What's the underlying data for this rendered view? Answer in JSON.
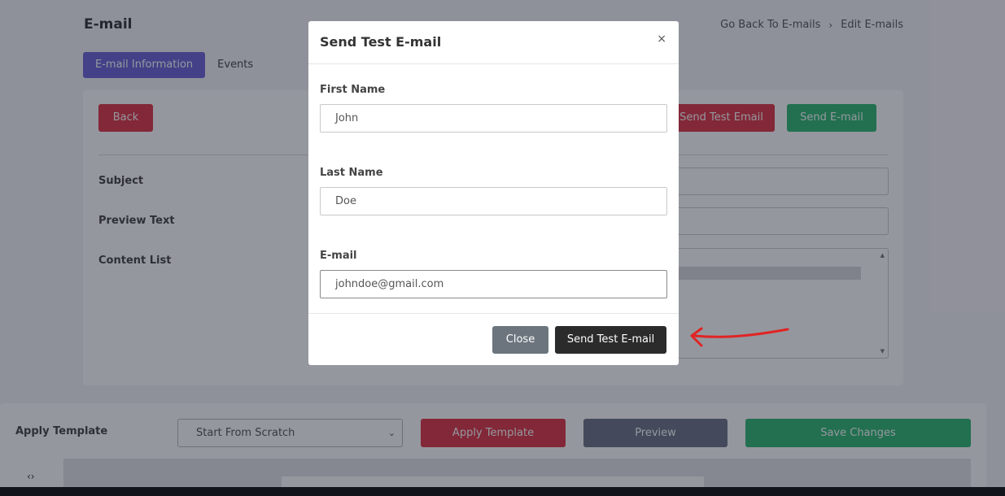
{
  "page": {
    "title": "E-mail",
    "breadcrumb": [
      "Go Back To E-mails",
      "›",
      "Edit E-mails"
    ],
    "tabs": [
      "E-mail Information",
      "Events"
    ]
  },
  "card": {
    "back_label": "Back",
    "send_test_label": "Send Test Email",
    "send_email_label": "Send E-mail",
    "fields": [
      "Subject",
      "Preview Text",
      "Content List"
    ]
  },
  "bottom": {
    "apply_label": "Apply Template",
    "select_value": "Start From Scratch",
    "apply_button": "Apply Template",
    "preview_button": "Preview",
    "save_button": "Save Changes",
    "code_toggle": "‹›"
  },
  "modal": {
    "title": "Send Test E-mail",
    "close_glyph": "×",
    "first_name_label": "First Name",
    "first_name_value": "John",
    "last_name_label": "Last Name",
    "last_name_value": "Doe",
    "email_label": "E-mail",
    "email_value": "johndoe@gmail.com",
    "close_button": "Close",
    "send_button": "Send Test E-mail"
  },
  "colors": {
    "primary_tab": "#6c63d8",
    "danger": "#dc3545",
    "success": "#2eb872",
    "secondary": "#6c757d",
    "dark": "#2b2b2b",
    "annotation": "#e02424"
  },
  "icons": {
    "close": "close-icon",
    "select_caret": "chevron-down-icon",
    "code": "code-icon",
    "annotation": "arrow-annotation-icon"
  }
}
